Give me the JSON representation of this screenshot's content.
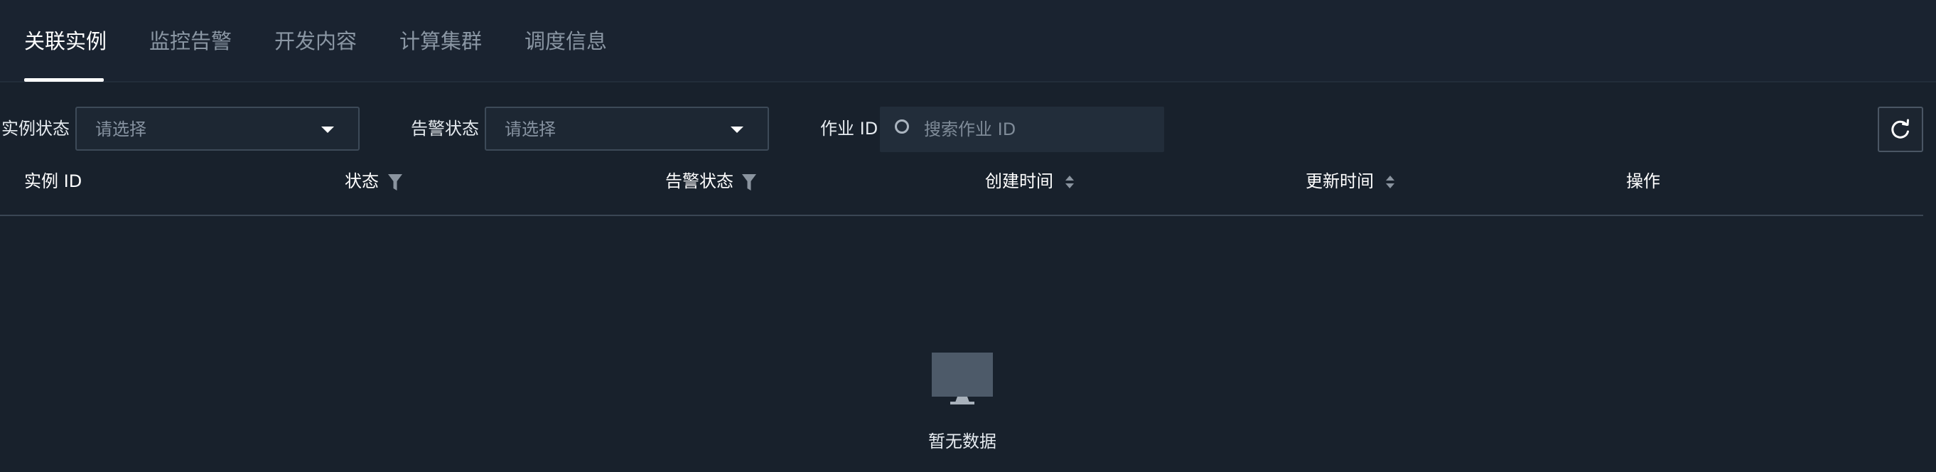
{
  "tabs": [
    {
      "label": "关联实例",
      "active": true
    },
    {
      "label": "监控告警",
      "active": false
    },
    {
      "label": "开发内容",
      "active": false
    },
    {
      "label": "计算集群",
      "active": false
    },
    {
      "label": "调度信息",
      "active": false
    }
  ],
  "filters": {
    "instance_status": {
      "label": "实例状态",
      "placeholder": "请选择"
    },
    "alert_status": {
      "label": "告警状态",
      "placeholder": "请选择"
    },
    "job_id": {
      "label": "作业 ID",
      "placeholder": "搜索作业 ID"
    }
  },
  "table": {
    "columns": [
      {
        "label": "实例 ID"
      },
      {
        "label": "状态",
        "control": "filter-icon"
      },
      {
        "label": "告警状态",
        "control": "filter-icon"
      },
      {
        "label": "创建时间",
        "control": "sort-icon"
      },
      {
        "label": "更新时间",
        "control": "sort-icon"
      },
      {
        "label": "操作"
      }
    ],
    "empty_text": "暂无数据"
  },
  "icons": {
    "search": "search-icon",
    "refresh": "refresh-icon",
    "caret": "caret-down-icon",
    "empty": "monitor-icon"
  },
  "colors": {
    "background": "#18212c",
    "tab_active": "#ffffff",
    "tab_inactive": "#8a96a3",
    "input_background": "#1d2733",
    "border": "#3d4a58"
  }
}
